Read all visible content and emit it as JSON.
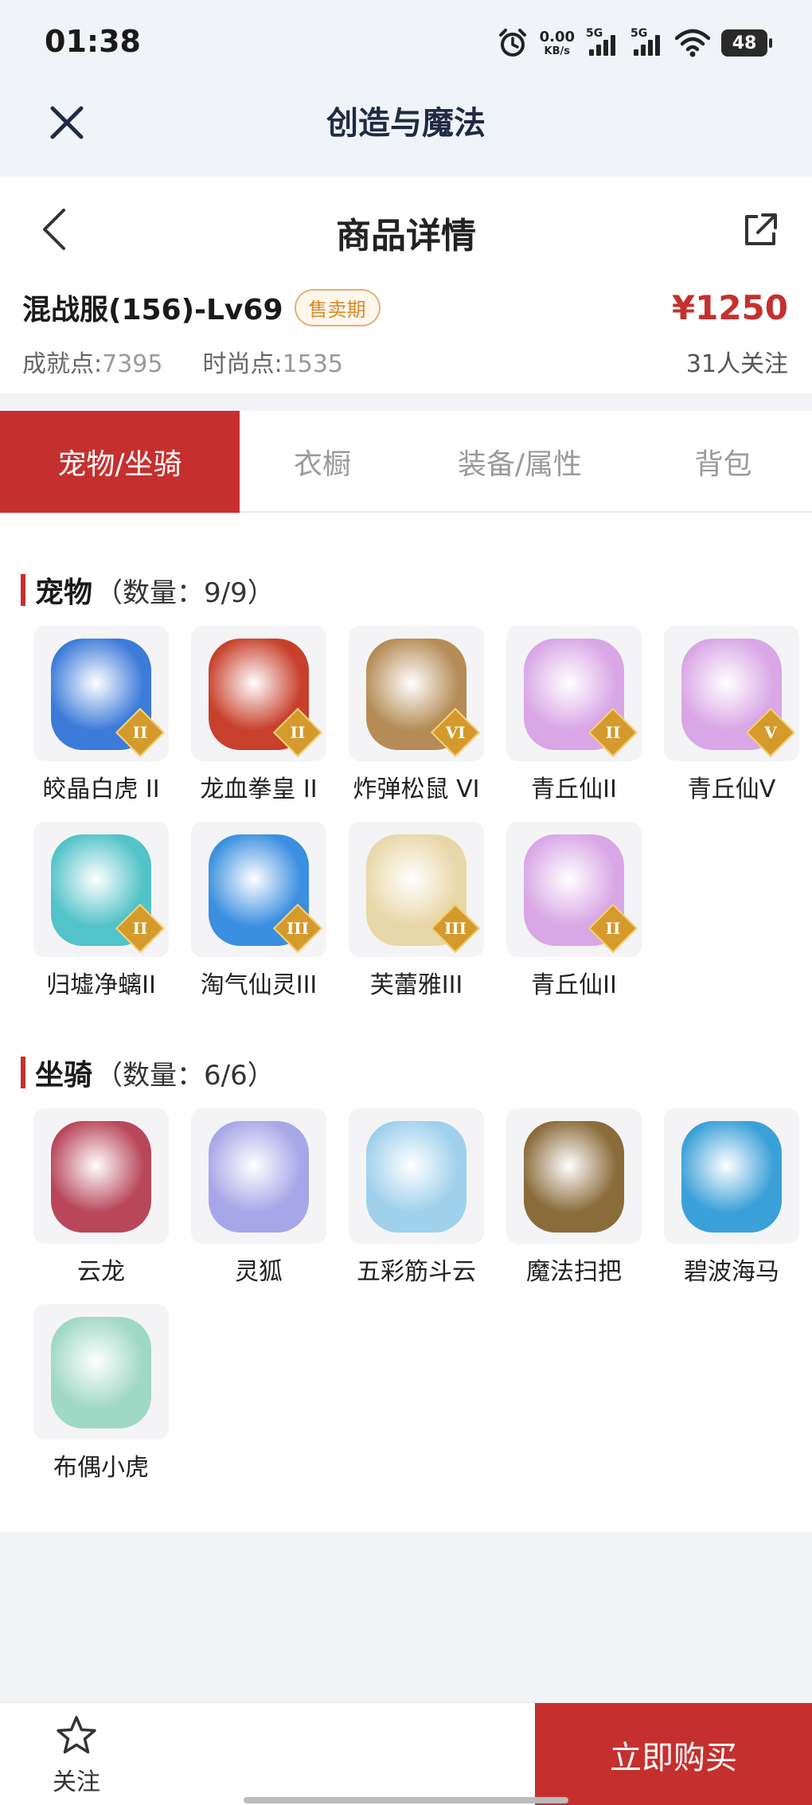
{
  "status": {
    "time": "01:38",
    "speed_value": "0.00",
    "speed_unit": "KB/s",
    "signal1": "5G",
    "signal2": "5G",
    "battery": "48",
    "icons": [
      "alarm-icon",
      "signal-icon",
      "wifi-icon",
      "battery-icon"
    ]
  },
  "appbar": {
    "title": "创造与魔法",
    "close_icon": "close-icon"
  },
  "navbar": {
    "title": "商品详情",
    "back_icon": "chevron-left-icon",
    "share_icon": "share-icon"
  },
  "product": {
    "name": "混战服(156)-Lv69",
    "badge": "售卖期",
    "price": "¥1250",
    "achieve_label": "成就点:",
    "achieve_value": "7395",
    "fashion_label": "时尚点:",
    "fashion_value": "1535",
    "followers": "31人关注"
  },
  "tabs": [
    {
      "label": "宠物/坐骑",
      "active": true
    },
    {
      "label": "衣橱",
      "active": false
    },
    {
      "label": "装备/属性",
      "active": false
    },
    {
      "label": "背包",
      "active": false
    }
  ],
  "pets": {
    "title": "宠物",
    "count": "（数量：9/9）",
    "items": [
      {
        "name": "皎晶白虎 II",
        "rank": "II",
        "color": "#3d7bd9"
      },
      {
        "name": "龙血拳皇 II",
        "rank": "II",
        "color": "#c8402c"
      },
      {
        "name": "炸弹松鼠 VI",
        "rank": "VI",
        "color": "#b58c55"
      },
      {
        "name": "青丘仙II",
        "rank": "II",
        "color": "#d9a6e6"
      },
      {
        "name": "青丘仙V",
        "rank": "V",
        "color": "#d9a6e6"
      },
      {
        "name": "归墟净螭II",
        "rank": "II",
        "color": "#52c3c8"
      },
      {
        "name": "淘气仙灵III",
        "rank": "III",
        "color": "#3a8fe0"
      },
      {
        "name": "芙蕾雅III",
        "rank": "III",
        "color": "#e8d7a8"
      },
      {
        "name": "青丘仙II",
        "rank": "II",
        "color": "#d9a6e6"
      }
    ]
  },
  "mounts": {
    "title": "坐骑",
    "count": "（数量：6/6）",
    "items": [
      {
        "name": "云龙",
        "color": "#b8475a"
      },
      {
        "name": "灵狐",
        "color": "#a7a6e8"
      },
      {
        "name": "五彩筋斗云",
        "color": "#9fd0ec"
      },
      {
        "name": "魔法扫把",
        "color": "#8a6b3a"
      },
      {
        "name": "碧波海马",
        "color": "#3aa0d8"
      },
      {
        "name": "布偶小虎",
        "color": "#9fd8c4"
      }
    ]
  },
  "bottom": {
    "follow_label": "关注",
    "follow_icon": "star-icon",
    "buy_label": "立即购买"
  },
  "colors": {
    "accent": "#c5302e",
    "badge": "#d7892d",
    "rank": "#d59a2c"
  }
}
